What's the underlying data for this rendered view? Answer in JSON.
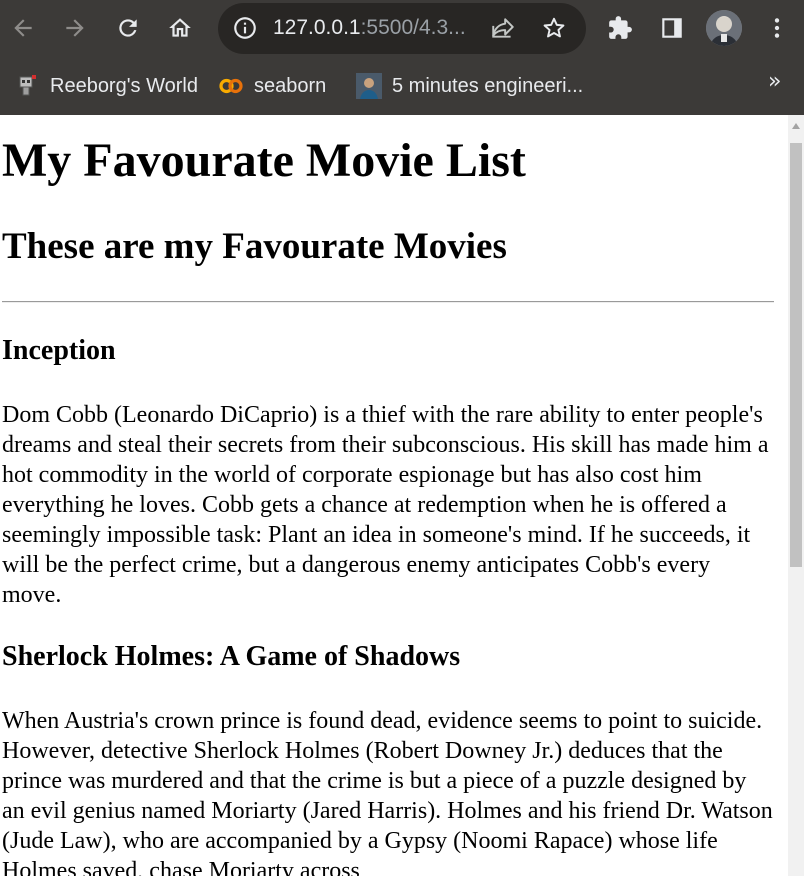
{
  "browser": {
    "url_host": "127.0.0.1",
    "url_rest": ":5500/4.3...",
    "bookmarks": [
      {
        "label": "Reeborg's World",
        "icon": "robot-icon"
      },
      {
        "label": "seaborn",
        "icon": "colab-icon"
      },
      {
        "label": "5 minutes engineeri...",
        "icon": "person-icon"
      }
    ],
    "more_bookmarks": "»"
  },
  "page": {
    "title": "My Favourate Movie List",
    "subtitle": "These are my Favourate Movies",
    "movies": [
      {
        "title": "Inception",
        "description": "Dom Cobb (Leonardo DiCaprio) is a thief with the rare ability to enter people's dreams and steal their secrets from their subconscious. His skill has made him a hot commodity in the world of corporate espionage but has also cost him everything he loves. Cobb gets a chance at redemption when he is offered a seemingly impossible task: Plant an idea in someone's mind. If he succeeds, it will be the perfect crime, but a dangerous enemy anticipates Cobb's every move."
      },
      {
        "title": "Sherlock Holmes: A Game of Shadows",
        "description": "When Austria's crown prince is found dead, evidence seems to point to suicide. However, detective Sherlock Holmes (Robert Downey Jr.) deduces that the prince was murdered and that the crime is but a piece of a puzzle designed by an evil genius named Moriarty (Jared Harris). Holmes and his friend Dr. Watson (Jude Law), who are accompanied by a Gypsy (Noomi Rapace) whose life Holmes saved, chase Moriarty across"
      }
    ]
  }
}
